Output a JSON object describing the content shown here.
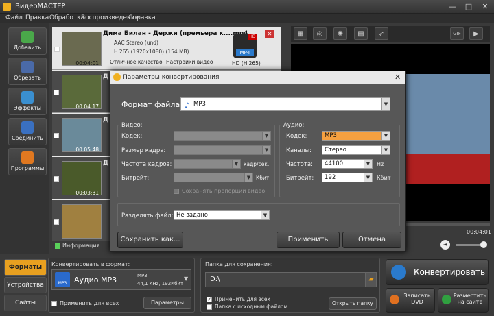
{
  "app": {
    "title": "ВидеоМАСТЕР",
    "minimize": "—",
    "maximize": "□",
    "close": "✕"
  },
  "menu": [
    "Файл",
    "Правка",
    "Обработка",
    "Воспроизведение",
    "Справка"
  ],
  "sidebar": [
    {
      "label": "Добавить",
      "color": "#4aa84a"
    },
    {
      "label": "Обрезать",
      "color": "#4a6aa8"
    },
    {
      "label": "Эффекты",
      "color": "#3a8fd0"
    },
    {
      "label": "Соединить",
      "color": "#3a70c0"
    },
    {
      "label": "Программы",
      "color": "#e07820"
    }
  ],
  "files": [
    {
      "title": "Дима Билан - Держи (премьера к....mp4",
      "audio": "AAC Stereo (und)",
      "video": "H.265 (1920x1080) (154 MB)",
      "quality": "Отличное качество",
      "settings": "Настройки видео",
      "format": "MP4",
      "format_detail": "HD (H.265)",
      "duration": "00:04:01",
      "badge": "HD"
    },
    {
      "title": "Д",
      "duration": "00:04:17"
    },
    {
      "title": "Д",
      "duration": "00:05:48"
    },
    {
      "title": "Д",
      "duration": "00:03:31"
    },
    {
      "title": "",
      "duration": ""
    }
  ],
  "filebar": {
    "info": "Информация"
  },
  "preview": {
    "time": "00:04:01",
    "gif": "GIF"
  },
  "dialog": {
    "title": "Параметры конвертирования",
    "format_label": "Формат файла:",
    "format_value": "MP3",
    "video_group": "Видео:",
    "video": [
      {
        "label": "Кодек:"
      },
      {
        "label": "Размер кадра:"
      },
      {
        "label": "Частота кадров:",
        "unit": "кадр/сек."
      },
      {
        "label": "Битрейт:",
        "unit": "Кбит"
      }
    ],
    "keep_ratio": "Сохранять пропорции видео",
    "audio_group": "Аудио:",
    "audio": [
      {
        "label": "Кодек:",
        "value": "MP3"
      },
      {
        "label": "Каналы:",
        "value": "Стерео"
      },
      {
        "label": "Частота:",
        "value": "44100",
        "unit": "Hz"
      },
      {
        "label": "Битрейт:",
        "value": "192",
        "unit": "Кбит"
      }
    ],
    "split_label": "Разделять файл:",
    "split_value": "Не задано",
    "save_as": "Сохранить как...",
    "apply": "Применить",
    "cancel": "Отмена"
  },
  "bottom": {
    "tabs": [
      "Форматы",
      "Устройства",
      "Сайты"
    ],
    "convert_to": "Конвертировать в формат:",
    "format_name": "Аудио MP3",
    "format_line1": "MP3",
    "format_line2": "44,1 KHz, 192Кбит",
    "format_icon": "MP3",
    "apply_all": "Применить для всех",
    "params": "Параметры",
    "save_folder": "Папка для сохранения:",
    "path": "D:\\",
    "apply_all2": "Применить для всех",
    "same_folder": "Папка с исходным файлом",
    "open_folder": "Открыть папку",
    "convert": "Конвертировать",
    "burn": "Записать DVD",
    "publish": "Разместить на сайте"
  }
}
